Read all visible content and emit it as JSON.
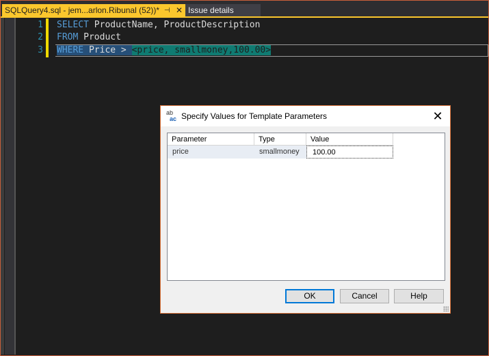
{
  "tabs": [
    {
      "label": "SQLQuery4.sql - jem...arlon.Ribunal (52))*",
      "pin_icon": "pin-icon",
      "close_icon": "close-icon"
    },
    {
      "label": "Issue details"
    }
  ],
  "tab_icons": {
    "pin": "⊣",
    "close": "✕"
  },
  "editor": {
    "line_numbers": [
      "1",
      "2",
      "3"
    ],
    "line1": {
      "kw": "SELECT",
      "rest": " ProductName, ProductDescription"
    },
    "line2": {
      "kw": "FROM",
      "rest": " Product"
    },
    "line3": {
      "kw": "WHERE",
      "rest": " Price > ",
      "param": "<price, smallmoney,100.00>"
    }
  },
  "dialog": {
    "title": "Specify Values for Template Parameters",
    "icon_text_top": "ab",
    "icon_text_bottom": "ac",
    "close_glyph": "✕",
    "columns": [
      "Parameter",
      "Type",
      "Value"
    ],
    "rows": [
      {
        "parameter": "price",
        "type": "smallmoney",
        "value": "100.00"
      }
    ],
    "buttons": {
      "ok": "OK",
      "cancel": "Cancel",
      "help": "Help"
    }
  },
  "colors": {
    "accent_tab": "#fbc72d",
    "dialog_border": "#e0763c",
    "keyword": "#569cd6",
    "line_number": "#2b91af"
  }
}
